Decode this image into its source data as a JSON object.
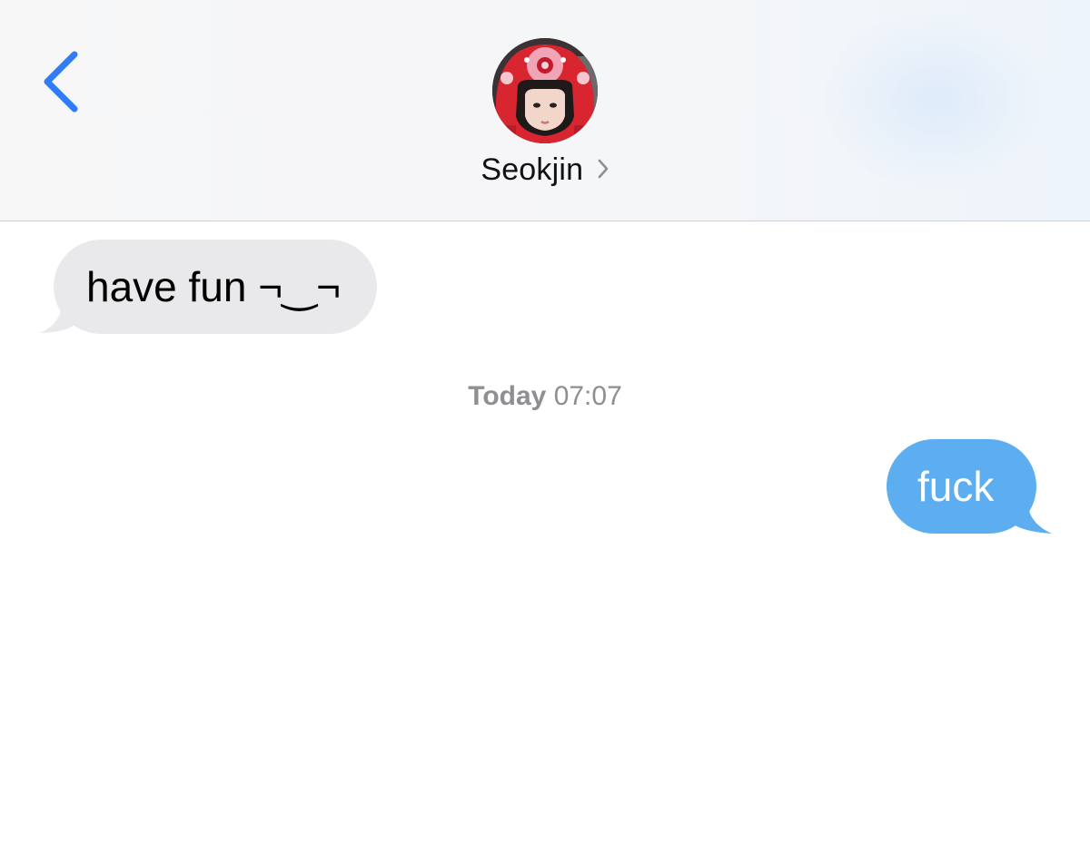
{
  "header": {
    "back_icon": "chevron-left-icon",
    "contact_name": "Seokjin",
    "contact_chevron_icon": "chevron-right-icon"
  },
  "conversation": {
    "messages": [
      {
        "direction": "incoming",
        "text": "have fun ¬‿¬"
      }
    ],
    "timestamp": {
      "day": "Today",
      "time": "07:07"
    },
    "messages_after": [
      {
        "direction": "outgoing",
        "text": "fuck"
      }
    ]
  },
  "colors": {
    "accent": "#2f7cf6",
    "incoming_bubble": "#e9e9eb",
    "outgoing_bubble": "#5daef1",
    "timestamp_text": "#8e8e93"
  }
}
